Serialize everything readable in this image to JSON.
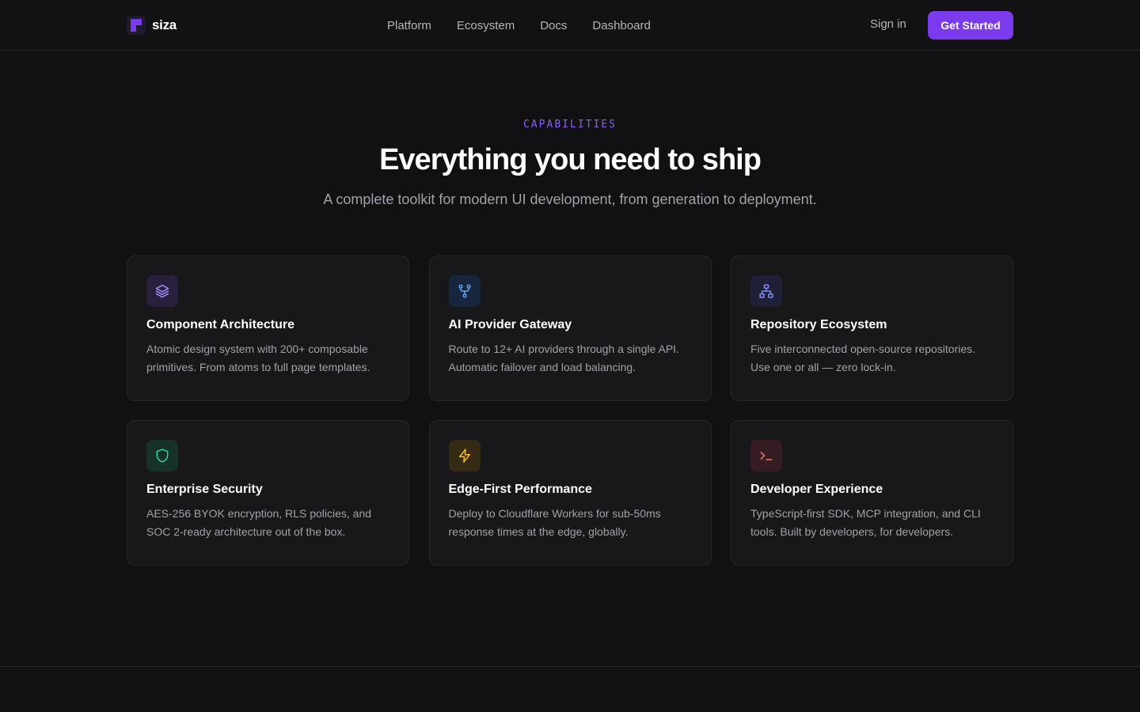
{
  "brand": {
    "name": "siza",
    "accent": "#7c3aed"
  },
  "nav": {
    "links": [
      "Platform",
      "Ecosystem",
      "Docs",
      "Dashboard"
    ],
    "signin": "Sign in",
    "cta": "Get Started"
  },
  "hero": {
    "eyebrow": "CAPABILITIES",
    "title": "Everything you need to ship",
    "subtitle": "A complete toolkit for modern UI development, from generation to deployment."
  },
  "features": [
    {
      "icon": "layers-icon",
      "color": "#a78bfa",
      "bg": "#2a1f3d",
      "title": "Component Architecture",
      "desc": "Atomic design system with 200+ composable primitives. From atoms to full page templates."
    },
    {
      "icon": "git-fork-icon",
      "color": "#60a5fa",
      "bg": "#17263d",
      "title": "AI Provider Gateway",
      "desc": "Route to 12+ AI providers through a single API. Automatic failover and load balancing."
    },
    {
      "icon": "network-icon",
      "color": "#818cf8",
      "bg": "#1f2038",
      "title": "Repository Ecosystem",
      "desc": "Five interconnected open-source repositories. Use one or all — zero lock-in."
    },
    {
      "icon": "shield-icon",
      "color": "#34d399",
      "bg": "#16302a",
      "title": "Enterprise Security",
      "desc": "AES-256 BYOK encryption, RLS policies, and SOC 2-ready architecture out of the box."
    },
    {
      "icon": "zap-icon",
      "color": "#fbbf24",
      "bg": "#352a14",
      "title": "Edge-First Performance",
      "desc": "Deploy to Cloudflare Workers for sub-50ms response times at the edge, globally."
    },
    {
      "icon": "terminal-icon",
      "color": "#f87171",
      "bg": "#351c22",
      "title": "Developer Experience",
      "desc": "TypeScript-first SDK, MCP integration, and CLI tools. Built by developers, for developers."
    }
  ]
}
